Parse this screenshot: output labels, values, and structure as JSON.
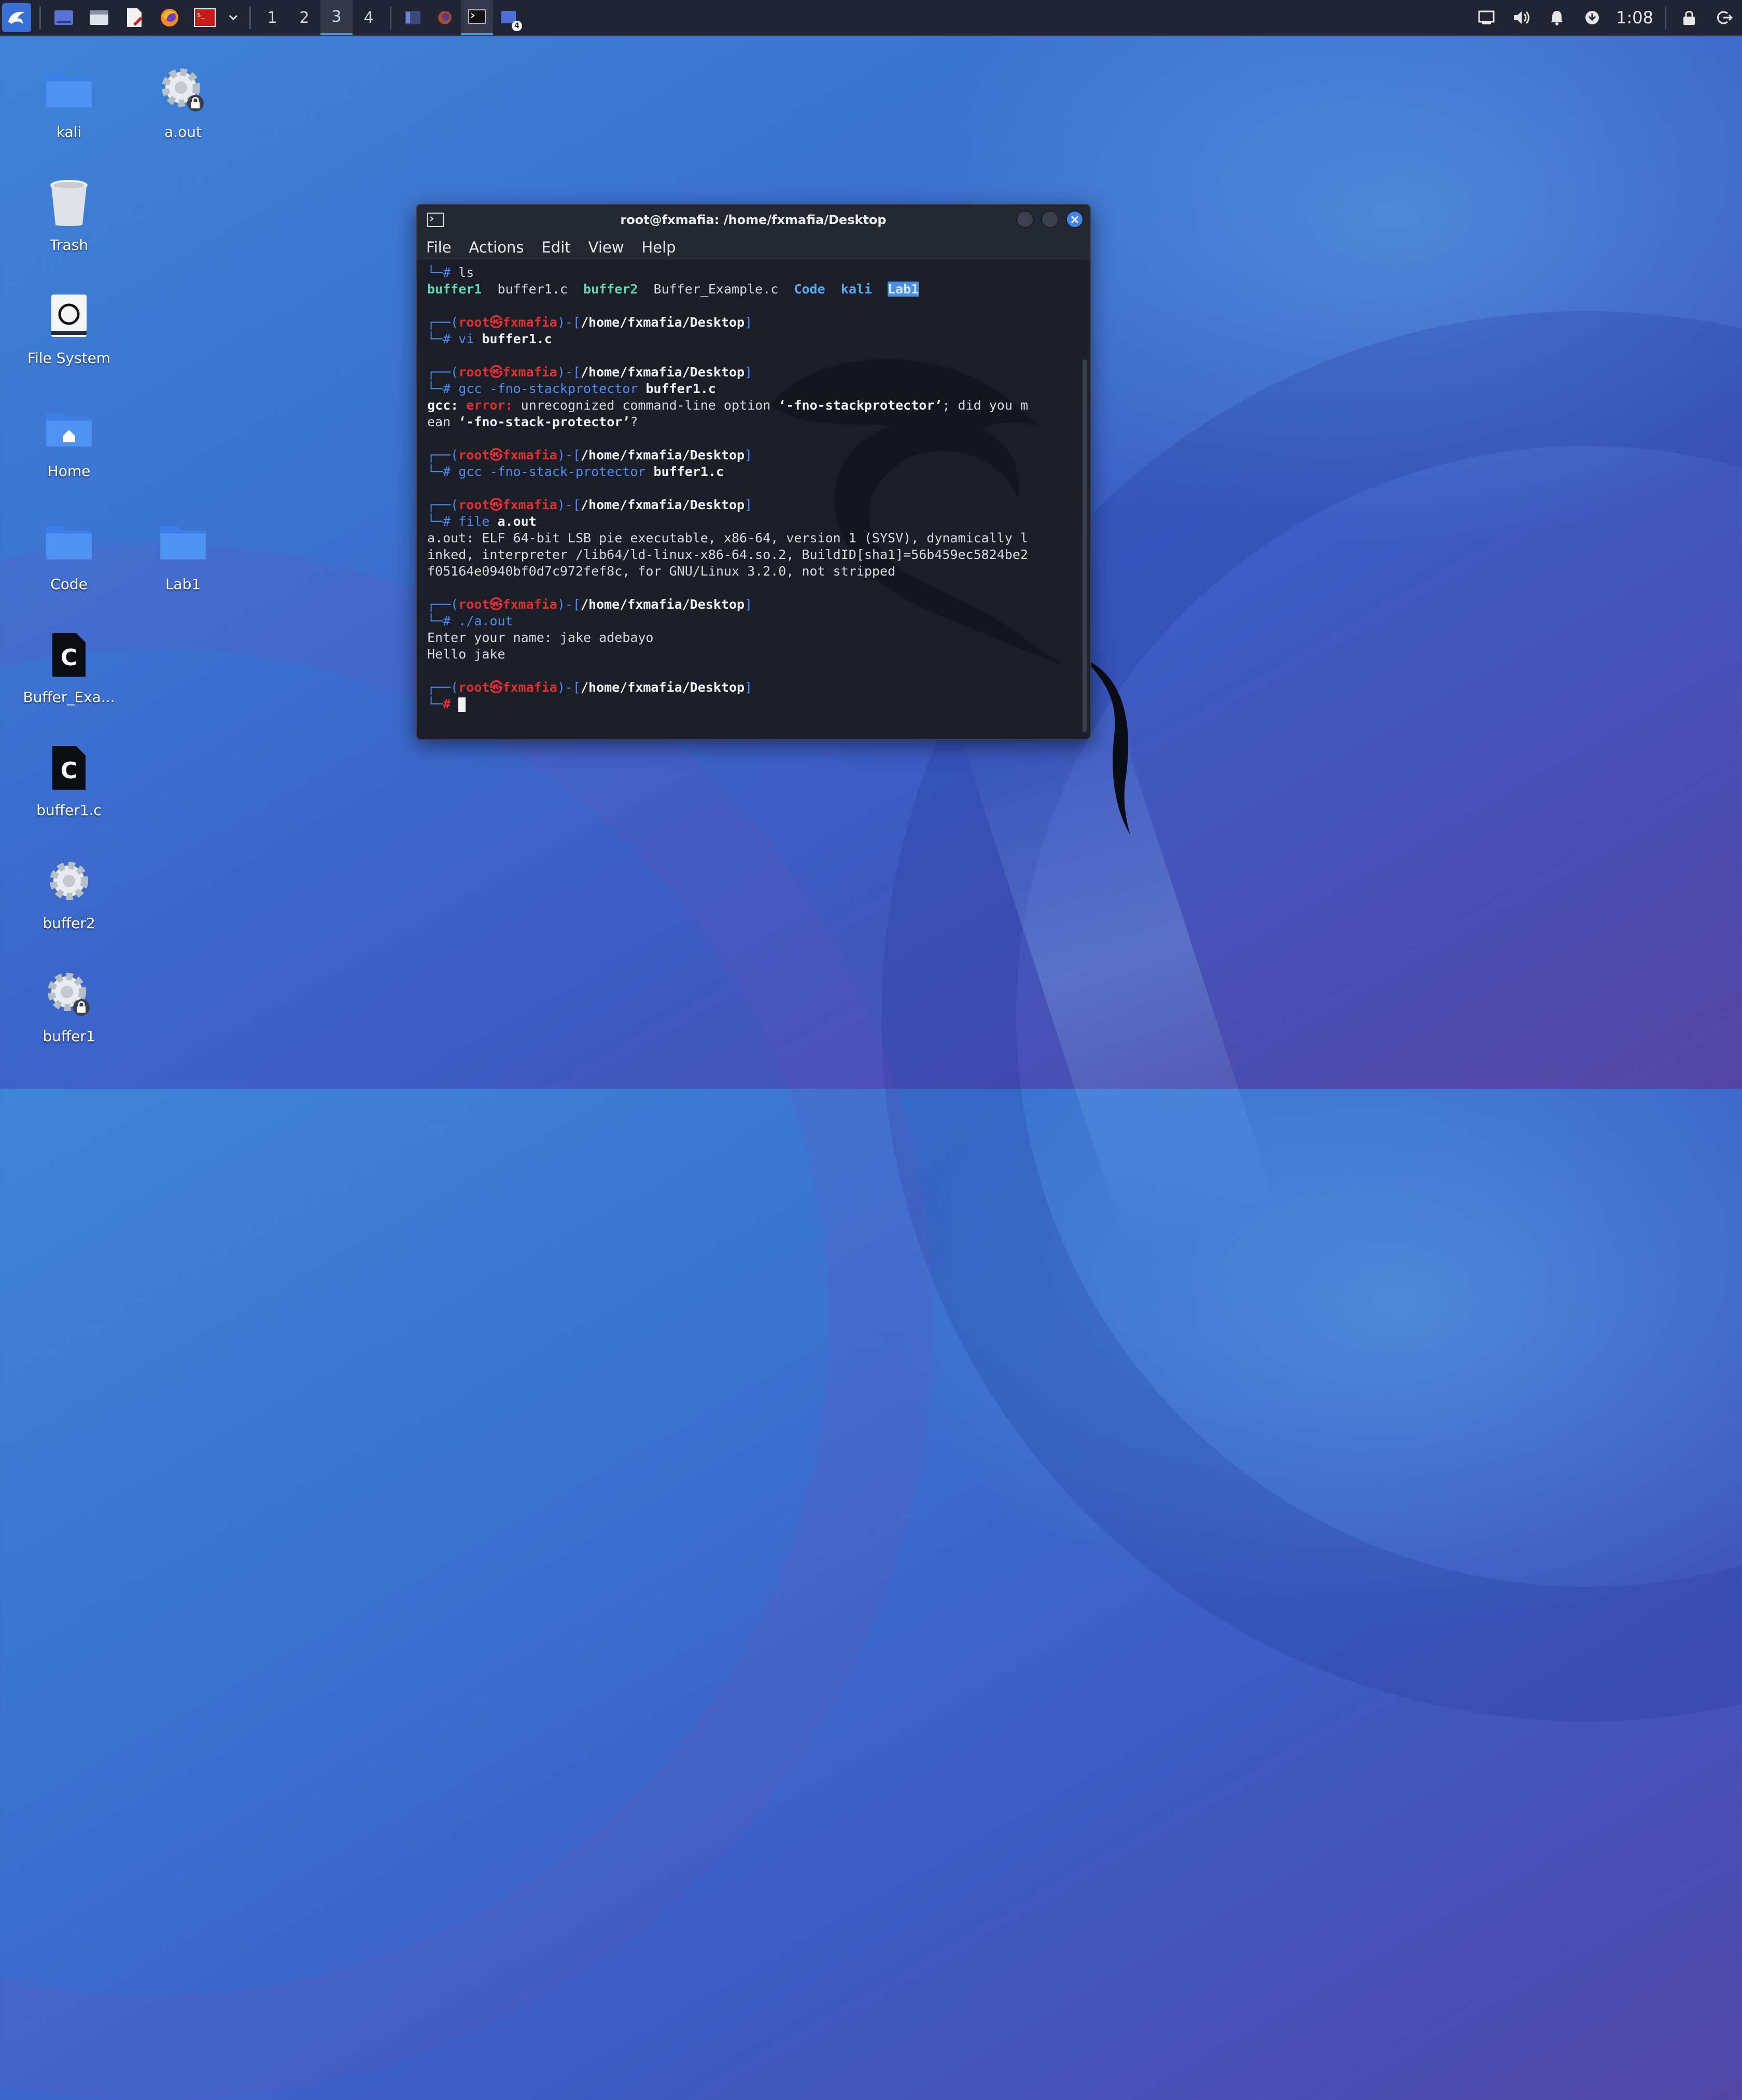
{
  "panel": {
    "workspaces": [
      "1",
      "2",
      "3",
      "4"
    ],
    "active_workspace": "3",
    "clock": "1:08",
    "task_badge": "4"
  },
  "desktop": {
    "icons": [
      {
        "label": "kali",
        "icon": "folder-icon"
      },
      {
        "label": "a.out",
        "icon": "gear-lock-icon"
      },
      {
        "label": "Trash",
        "icon": "trash-icon"
      },
      {
        "label": "File System",
        "icon": "drive-icon"
      },
      {
        "label": "Home",
        "icon": "home-folder-icon"
      },
      {
        "label": "Code",
        "icon": "folder-icon"
      },
      {
        "label": "Lab1",
        "icon": "folder-icon"
      },
      {
        "label": "Buffer_Exa...",
        "icon": "c-file-icon"
      },
      {
        "label": "buffer1.c",
        "icon": "c-file-icon"
      },
      {
        "label": "buffer2",
        "icon": "gear-icon"
      },
      {
        "label": "buffer1",
        "icon": "gear-lock-icon"
      }
    ]
  },
  "terminal": {
    "title": "root@fxmafia: /home/fxmafia/Desktop",
    "menu": [
      "File",
      "Actions",
      "Edit",
      "View",
      "Help"
    ],
    "prompt": {
      "user": "root",
      "host": "fxmafia",
      "path": "/home/fxmafia/Desktop"
    },
    "ls_cmd": "ls",
    "ls_out": [
      "buffer1",
      "buffer1.c",
      "buffer2",
      "Buffer_Example.c",
      "Code",
      "kali",
      "Lab1"
    ],
    "cmd1": {
      "name": "vi",
      "arg": "buffer1.c"
    },
    "cmd2": {
      "name": "gcc -fno-stackprotector",
      "arg": "buffer1.c"
    },
    "err": {
      "prefix": "gcc:",
      "label": "error:",
      "text1": "unrecognized command-line option",
      "opt1": "‘-fno-stackprotector’",
      "text2": "; did you m",
      "text3": "ean",
      "opt2": "‘-fno-stack-protector’",
      "text4": "?"
    },
    "cmd3": {
      "name": "gcc -fno-stack-protector",
      "arg": "buffer1.c"
    },
    "cmd4": {
      "name": "file",
      "arg": "a.out"
    },
    "file_out": [
      "a.out: ELF 64-bit LSB pie executable, x86-64, version 1 (SYSV), dynamically l",
      "inked, interpreter /lib64/ld-linux-x86-64.so.2, BuildID[sha1]=56b459ec5824be2",
      "f05164e0940bf0d7c972fef8c, for GNU/Linux 3.2.0, not stripped"
    ],
    "cmd5": "./a.out",
    "run_out": [
      "Enter your name: jake adebayo",
      "Hello jake"
    ],
    "hash": "#"
  },
  "colors": {
    "accent": "#4a8fe0",
    "prompt_red": "#e03030",
    "exec_green": "#5fd7af",
    "dir_blue": "#4fb0f0"
  }
}
